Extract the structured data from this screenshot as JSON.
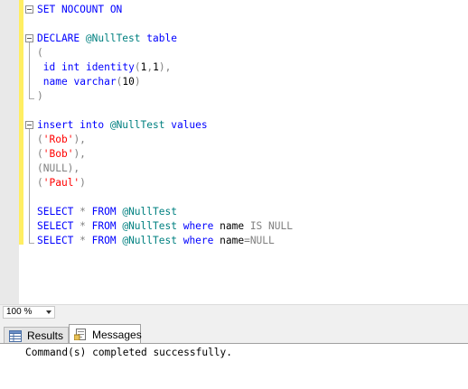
{
  "editor": {
    "lines": [
      [
        {
          "t": "SET NOCOUNT ON",
          "c": "kw"
        }
      ],
      [],
      [
        {
          "t": "DECLARE ",
          "c": "kw"
        },
        {
          "t": "@NullTest",
          "c": "vr"
        },
        {
          "t": " ",
          "c": ""
        },
        {
          "t": "table",
          "c": "kw"
        }
      ],
      [
        {
          "t": "(",
          "c": "gr"
        }
      ],
      [
        {
          "t": " ",
          "c": ""
        },
        {
          "t": "id",
          "c": "kw"
        },
        {
          "t": " ",
          "c": ""
        },
        {
          "t": "int",
          "c": "kw"
        },
        {
          "t": " ",
          "c": ""
        },
        {
          "t": "identity",
          "c": "kw"
        },
        {
          "t": "(",
          "c": "gr"
        },
        {
          "t": "1",
          "c": ""
        },
        {
          "t": ",",
          "c": "gr"
        },
        {
          "t": "1",
          "c": ""
        },
        {
          "t": "),",
          "c": "gr"
        }
      ],
      [
        {
          "t": " ",
          "c": ""
        },
        {
          "t": "name",
          "c": "kw"
        },
        {
          "t": " ",
          "c": ""
        },
        {
          "t": "varchar",
          "c": "kw"
        },
        {
          "t": "(",
          "c": "gr"
        },
        {
          "t": "10",
          "c": ""
        },
        {
          "t": ")",
          "c": "gr"
        }
      ],
      [
        {
          "t": ")",
          "c": "gr"
        }
      ],
      [],
      [
        {
          "t": "insert into ",
          "c": "kw"
        },
        {
          "t": "@NullTest",
          "c": "vr"
        },
        {
          "t": " ",
          "c": ""
        },
        {
          "t": "values",
          "c": "kw"
        }
      ],
      [
        {
          "t": "(",
          "c": "gr"
        },
        {
          "t": "'Rob'",
          "c": "st"
        },
        {
          "t": "),",
          "c": "gr"
        }
      ],
      [
        {
          "t": "(",
          "c": "gr"
        },
        {
          "t": "'Bob'",
          "c": "st"
        },
        {
          "t": "),",
          "c": "gr"
        }
      ],
      [
        {
          "t": "(NULL),",
          "c": "gr"
        }
      ],
      [
        {
          "t": "(",
          "c": "gr"
        },
        {
          "t": "'Paul'",
          "c": "st"
        },
        {
          "t": ")",
          "c": "gr"
        }
      ],
      [],
      [
        {
          "t": "SELECT ",
          "c": "kw"
        },
        {
          "t": "* ",
          "c": "gr"
        },
        {
          "t": "FROM ",
          "c": "kw"
        },
        {
          "t": "@NullTest",
          "c": "vr"
        }
      ],
      [
        {
          "t": "SELECT ",
          "c": "kw"
        },
        {
          "t": "* ",
          "c": "gr"
        },
        {
          "t": "FROM ",
          "c": "kw"
        },
        {
          "t": "@NullTest",
          "c": "vr"
        },
        {
          "t": " ",
          "c": ""
        },
        {
          "t": "where",
          "c": "kw"
        },
        {
          "t": " name ",
          "c": ""
        },
        {
          "t": "IS NULL",
          "c": "gr"
        }
      ],
      [
        {
          "t": "SELECT ",
          "c": "kw"
        },
        {
          "t": "* ",
          "c": "gr"
        },
        {
          "t": "FROM ",
          "c": "kw"
        },
        {
          "t": "@NullTest",
          "c": "vr"
        },
        {
          "t": " ",
          "c": ""
        },
        {
          "t": "where",
          "c": "kw"
        },
        {
          "t": " name",
          "c": ""
        },
        {
          "t": "=NULL",
          "c": "gr"
        }
      ]
    ]
  },
  "zoom": {
    "value": "100 %"
  },
  "tabs": {
    "results_label": "Results",
    "messages_label": "Messages"
  },
  "messages": {
    "text": "Command(s) completed successfully."
  },
  "colors": {
    "keyword": "#0000ff",
    "operator": "#808080",
    "string": "#ff0000",
    "variable": "#008080",
    "change_bar": "#ffee62"
  }
}
